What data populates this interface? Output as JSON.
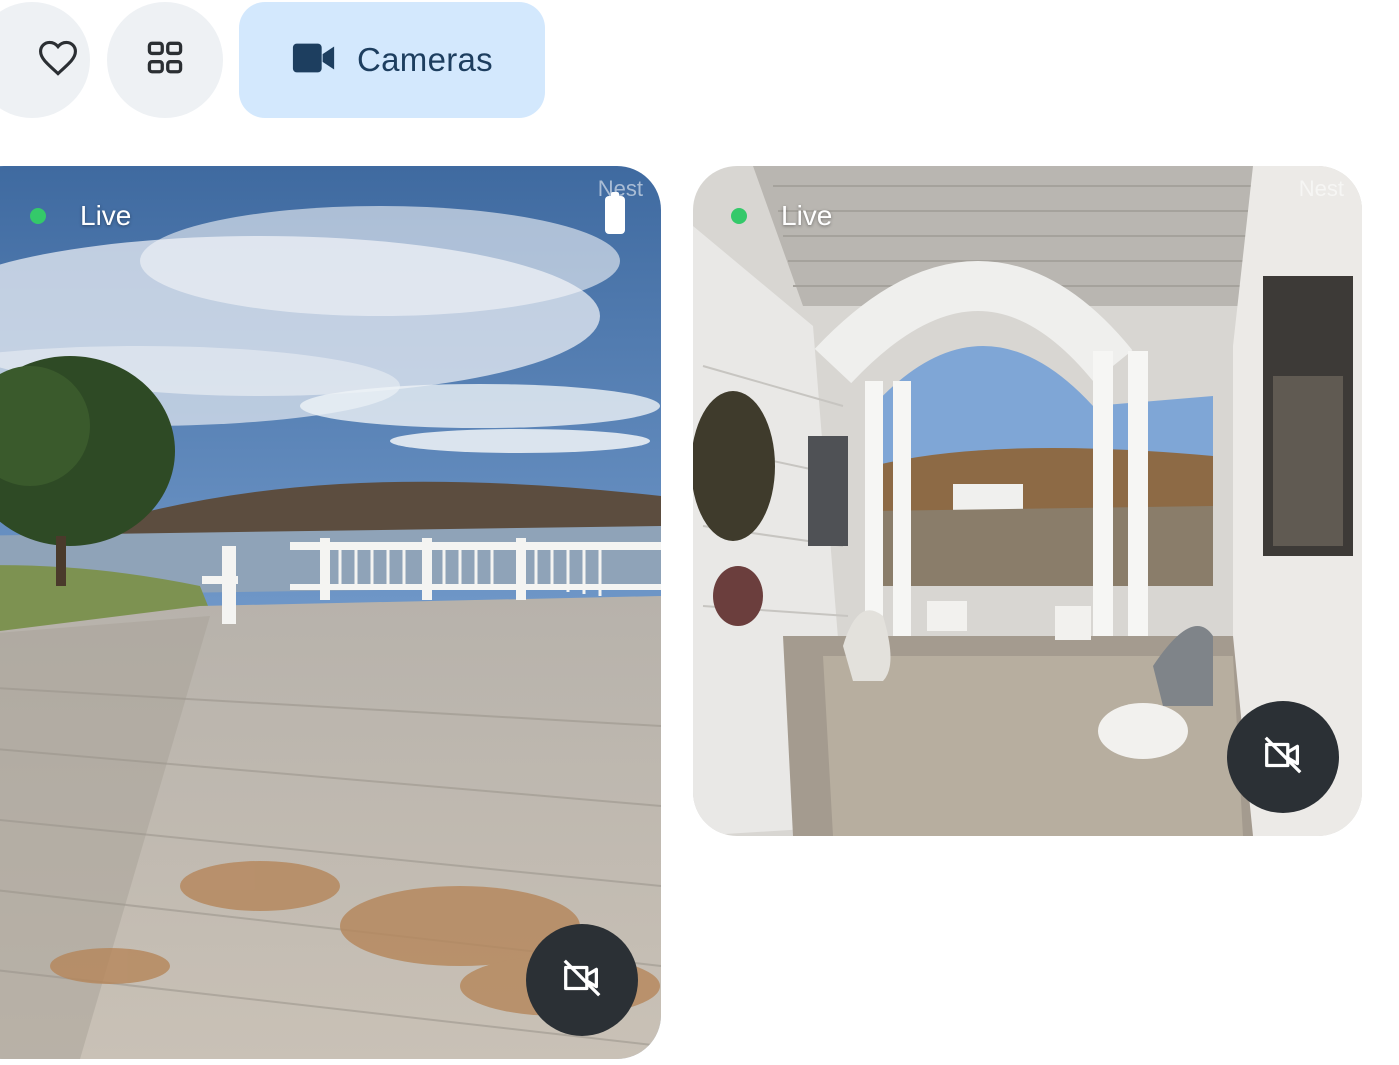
{
  "toolbar": {
    "favorites_icon": "heart-outline-icon",
    "dashboard_icon": "grid-2x2-icon",
    "cameras": {
      "icon": "videocam-icon",
      "label": "Cameras"
    }
  },
  "cameras": [
    {
      "status_label": "Live",
      "brand": "Nest",
      "battery_icon": "battery-full-icon",
      "toggle_icon": "videocam-off-icon",
      "scene": "waterfront-deck"
    },
    {
      "status_label": "Live",
      "brand": "Nest",
      "toggle_icon": "videocam-off-icon",
      "scene": "front-porch"
    }
  ],
  "colors": {
    "chip_bg": "#eef1f4",
    "cameras_bg": "#d3e8fd",
    "cameras_text": "#1d3e5f",
    "live_dot": "#34c96a",
    "off_button_bg": "#2b3035"
  }
}
